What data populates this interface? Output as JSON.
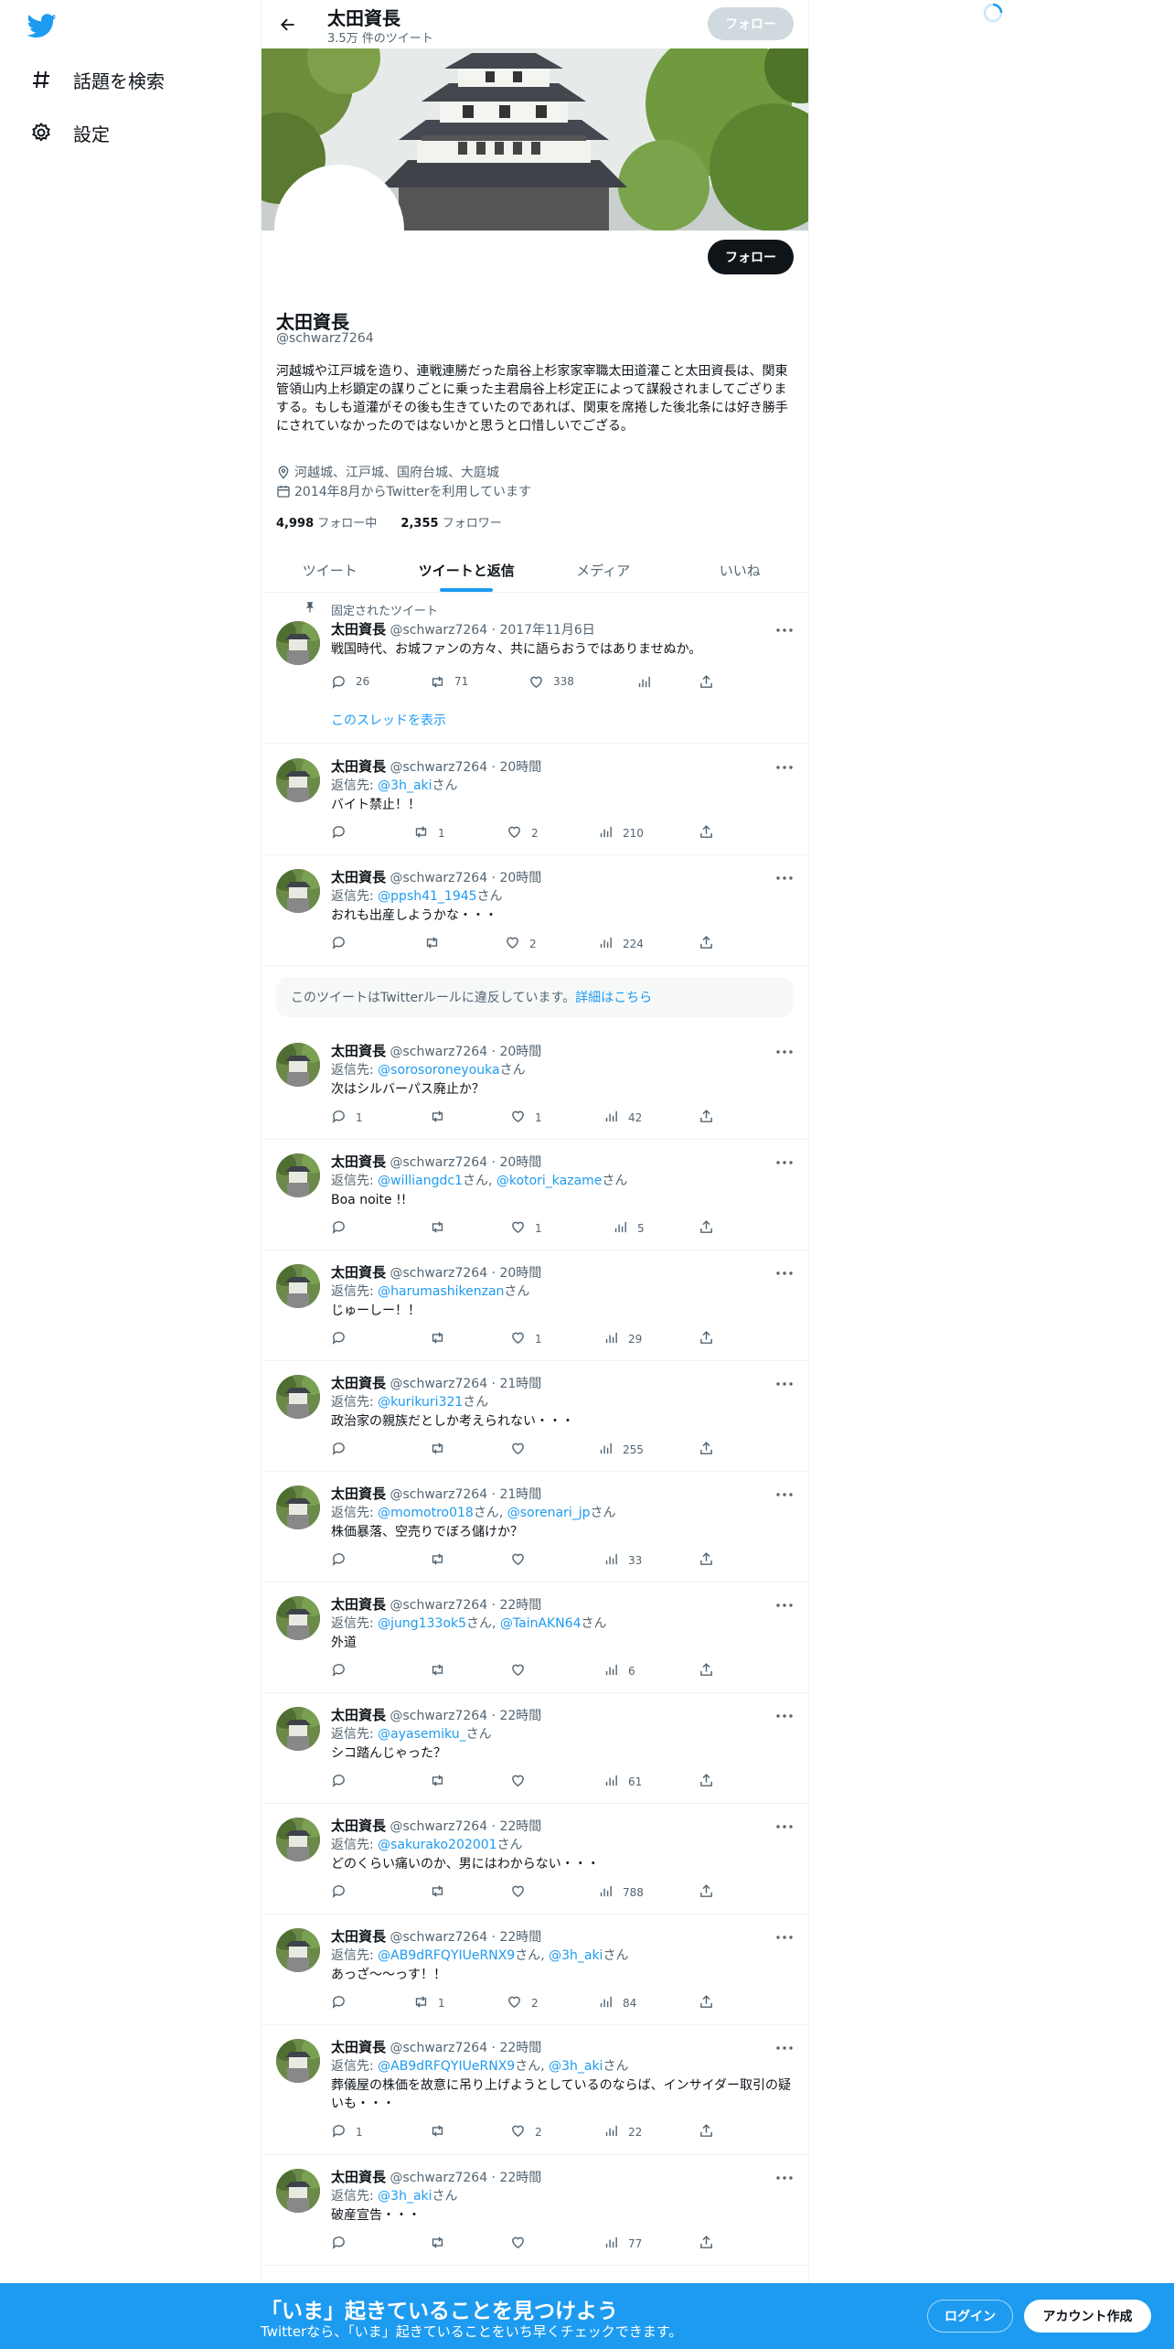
{
  "nav": {
    "explore_label": "話題を検索",
    "settings_label": "設定"
  },
  "header": {
    "name": "太田資長",
    "tweet_count": "3.5万 件のツイート",
    "follow_label": "フォロー"
  },
  "profile": {
    "name": "太田資長",
    "handle": "@schwarz7264",
    "bio": "河越城や江戸城を造り、連戦連勝だった扇谷上杉家家宰職太田道灌こと太田資長は、関東管領山内上杉顕定の謀りごとに乗った主君扇谷上杉定正によって謀殺されましてござりまする。もしも道灌がその後も生きていたのであれば、関東を席捲した後北条には好き勝手にされていなかったのではないかと思うと口惜しいでござる。",
    "location": "河越城、江戸城、国府台城、大庭城",
    "joined": "2014年8月からTwitterを利用しています",
    "following_count": "4,998",
    "following_label": "フォロー中",
    "followers_count": "2,355",
    "followers_label": "フォロワー",
    "follow_label": "フォロー"
  },
  "tabs": [
    "ツイート",
    "ツイートと返信",
    "メディア",
    "いいね"
  ],
  "pinned": {
    "label": "固定されたツイート",
    "name": "太田資長",
    "meta": "@schwarz7264 · 2017年11月6日",
    "text": "戦国時代、お城ファンの方々、共に語らおうではありませぬか。",
    "replies": "26",
    "retweets": "71",
    "likes": "338",
    "show_thread": "このスレッドを表示"
  },
  "notice": {
    "text": "このツイートはTwitterルールに違反しています。",
    "link": "詳細はこちら"
  },
  "reply_prefix": "返信先: ",
  "san": "さん",
  "tweets": [
    {
      "name": "太田資長",
      "meta": "@schwarz7264 · 20時間",
      "to1": "@3h_aki",
      "to2": "",
      "text": "バイト禁止！！",
      "replies": "",
      "retweets": "1",
      "likes": "2",
      "views": "210"
    },
    {
      "name": "太田資長",
      "meta": "@schwarz7264 · 20時間",
      "to1": "@ppsh41_1945",
      "to2": "",
      "text": "おれも出産しようかな・・・",
      "replies": "",
      "retweets": "",
      "likes": "2",
      "views": "224"
    },
    {
      "name": "太田資長",
      "meta": "@schwarz7264 · 20時間",
      "to1": "@sorosoroneyouka",
      "to2": "",
      "text": "次はシルバーパス廃止か？",
      "replies": "1",
      "retweets": "",
      "likes": "1",
      "views": "42"
    },
    {
      "name": "太田資長",
      "meta": "@schwarz7264 · 20時間",
      "to1": "@williangdc1",
      "to2": "@kotori_kazame",
      "text": "Boa noite !!",
      "replies": "",
      "retweets": "",
      "likes": "1",
      "views": "5"
    },
    {
      "name": "太田資長",
      "meta": "@schwarz7264 · 20時間",
      "to1": "@harumashikenzan",
      "to2": "",
      "text": "じゅーしー！！",
      "replies": "",
      "retweets": "",
      "likes": "1",
      "views": "29"
    },
    {
      "name": "太田資長",
      "meta": "@schwarz7264 · 21時間",
      "to1": "@kurikuri321",
      "to2": "",
      "text": "政治家の親族だとしか考えられない・・・",
      "replies": "",
      "retweets": "",
      "likes": "",
      "views": "255"
    },
    {
      "name": "太田資長",
      "meta": "@schwarz7264 · 21時間",
      "to1": "@momotro018",
      "to2": "@sorenari_jp",
      "text": "株価暴落、空売りでぼろ儲けか？",
      "replies": "",
      "retweets": "",
      "likes": "",
      "views": "33"
    },
    {
      "name": "太田資長",
      "meta": "@schwarz7264 · 22時間",
      "to1": "@jung133ok5",
      "to2": "@TainAKN64",
      "text": "外道",
      "replies": "",
      "retweets": "",
      "likes": "",
      "views": "6"
    },
    {
      "name": "太田資長",
      "meta": "@schwarz7264 · 22時間",
      "to1": "@ayasemiku_",
      "to2": "",
      "text": "シコ踏んじゃった？",
      "replies": "",
      "retweets": "",
      "likes": "",
      "views": "61"
    },
    {
      "name": "太田資長",
      "meta": "@schwarz7264 · 22時間",
      "to1": "@sakurako202001",
      "to2": "",
      "text": "どのくらい痛いのか、男にはわからない・・・",
      "replies": "",
      "retweets": "",
      "likes": "",
      "views": "788"
    },
    {
      "name": "太田資長",
      "meta": "@schwarz7264 · 22時間",
      "to1": "@AB9dRFQYIUeRNX9",
      "to2": "@3h_aki",
      "text": "あっざ～～っす！！",
      "replies": "",
      "retweets": "1",
      "likes": "2",
      "views": "84"
    },
    {
      "name": "太田資長",
      "meta": "@schwarz7264 · 22時間",
      "to1": "@AB9dRFQYIUeRNX9",
      "to2": "@3h_aki",
      "text": "葬儀屋の株価を故意に吊り上げようとしているのならば、インサイダー取引の疑いも・・・",
      "replies": "1",
      "retweets": "",
      "likes": "2",
      "views": "22"
    },
    {
      "name": "太田資長",
      "meta": "@schwarz7264 · 22時間",
      "to1": "@3h_aki",
      "to2": "",
      "text": "破産宣告・・・",
      "replies": "",
      "retweets": "",
      "likes": "",
      "views": "77"
    }
  ],
  "bottom": {
    "title": "「いま」起きていることを見つけよう",
    "subtitle": "Twitterなら、「いま」起きていることをいち早くチェックできます。",
    "login": "ログイン",
    "signup": "アカウント作成"
  },
  "colors": {
    "accent": "#1d9bf0",
    "text": "#0f1419",
    "muted": "#536471"
  }
}
